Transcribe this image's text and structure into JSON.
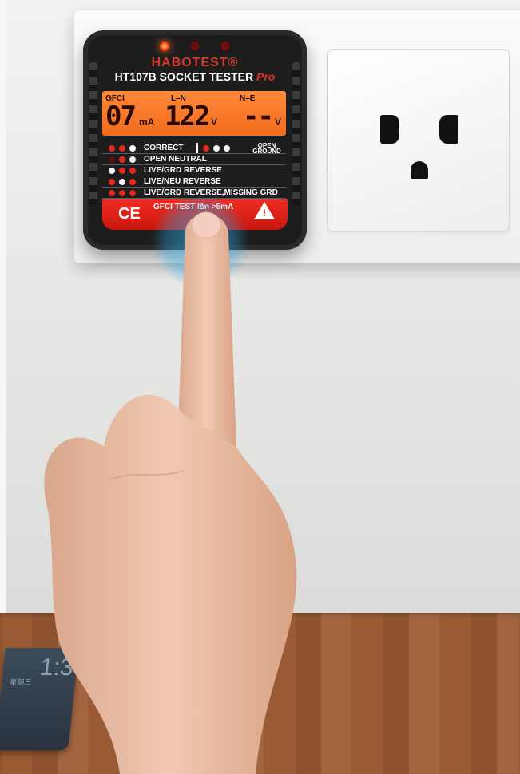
{
  "tester": {
    "brand": "HABOTEST®",
    "model": "HT107B SOCKET TESTER",
    "model_suffix": "Pro",
    "lcd": {
      "gfci_label": "GFCI",
      "gfci_value": "07",
      "gfci_unit": "mA",
      "ln_label": "L–N",
      "ln_value": "122",
      "ln_unit": "V",
      "ne_label": "N–E",
      "ne_value": "--",
      "ne_unit": "V"
    },
    "legend": [
      {
        "text": "CORRECT",
        "alt_text": "OPEN GROUND"
      },
      {
        "text": "OPEN NEUTRAL"
      },
      {
        "text": "LIVE/GRD REVERSE"
      },
      {
        "text": "LIVE/NEU REVERSE"
      },
      {
        "text": "LIVE/GRD REVERSE,MISSING GRD"
      }
    ],
    "ce_mark": "CE",
    "gfci_test_label": "GFCI TEST I∆n >5mA",
    "warning_mark": "!"
  },
  "phone": {
    "time": "1:30",
    "date": "星期三"
  },
  "colors": {
    "accent_red": "#e02a1f",
    "lcd_orange": "#f26a1e",
    "glow_blue": "#3cc8ff"
  }
}
